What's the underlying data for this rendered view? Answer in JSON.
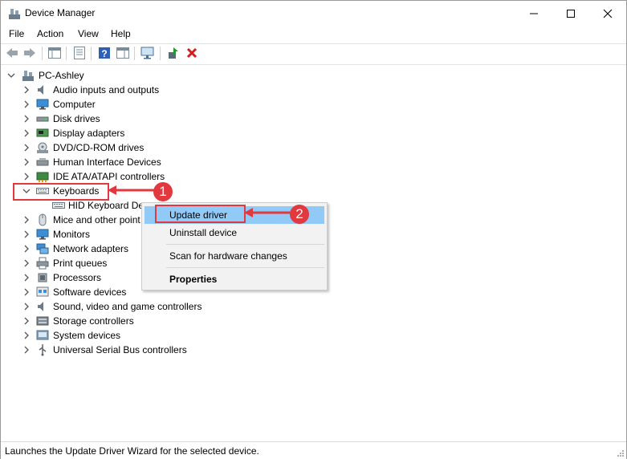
{
  "window": {
    "title": "Device Manager"
  },
  "menu": [
    "File",
    "Action",
    "View",
    "Help"
  ],
  "tree": {
    "root": "PC-Ashley",
    "categories": [
      {
        "label": "Audio inputs and outputs",
        "icon": "speaker-icon"
      },
      {
        "label": "Computer",
        "icon": "monitor-icon"
      },
      {
        "label": "Disk drives",
        "icon": "disk-drive-icon"
      },
      {
        "label": "Display adapters",
        "icon": "display-adapter-icon"
      },
      {
        "label": "DVD/CD-ROM drives",
        "icon": "dvd-drive-icon"
      },
      {
        "label": "Human Interface Devices",
        "icon": "hid-icon"
      },
      {
        "label": "IDE ATA/ATAPI controllers",
        "icon": "ide-controller-icon"
      },
      {
        "label": "Keyboards",
        "icon": "keyboard-icon"
      },
      {
        "label": "HID Keyboard De",
        "icon": "keyboard-icon"
      },
      {
        "label": "Mice and other point",
        "icon": "mouse-icon"
      },
      {
        "label": "Monitors",
        "icon": "monitor-icon"
      },
      {
        "label": "Network adapters",
        "icon": "network-adapter-icon"
      },
      {
        "label": "Print queues",
        "icon": "printer-icon"
      },
      {
        "label": "Processors",
        "icon": "processor-icon"
      },
      {
        "label": "Software devices",
        "icon": "software-device-icon"
      },
      {
        "label": "Sound, video and game controllers",
        "icon": "speaker-icon"
      },
      {
        "label": "Storage controllers",
        "icon": "storage-controller-icon"
      },
      {
        "label": "System devices",
        "icon": "system-device-icon"
      },
      {
        "label": "Universal Serial Bus controllers",
        "icon": "usb-icon"
      }
    ]
  },
  "context_menu": {
    "update": "Update driver",
    "uninstall": "Uninstall device",
    "scan": "Scan for hardware changes",
    "properties": "Properties"
  },
  "annotations": {
    "step1": "1",
    "step2": "2"
  },
  "status": "Launches the Update Driver Wizard for the selected device.",
  "colors": {
    "highlight": "#91c9f7",
    "annotation_red": "#e2393f"
  }
}
